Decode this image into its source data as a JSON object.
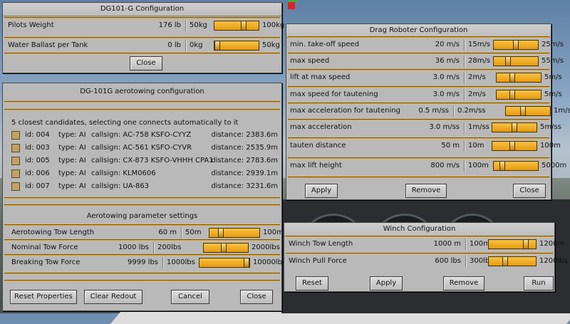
{
  "dg101": {
    "title": "DG101-G Configuration",
    "rows": [
      {
        "label": "Pilots Weight",
        "value": "176 lb",
        "min": "50kg",
        "max": "100kg",
        "pos": 0.68
      },
      {
        "label": "Water Ballast per Tank",
        "value": "0 lb",
        "min": "0kg",
        "max": "50kg",
        "pos": 0.0
      }
    ],
    "close": "Close"
  },
  "aerotow": {
    "title": "DG-101G aerotowing configuration",
    "intro": "5 closest candidates, selecting one connects automatically to it",
    "candidates": [
      {
        "id": "id: 004",
        "type": "type: AI",
        "callsign": "callsign: AC-758 KSFO-CYYZ",
        "distance": "distance: 2383.6m"
      },
      {
        "id": "id: 003",
        "type": "type: AI",
        "callsign": "callsign: AC-561 KSFO-CYVR",
        "distance": "distance: 2535.9m"
      },
      {
        "id": "id: 005",
        "type": "type: AI",
        "callsign": "callsign: CX-873 KSFO-VHHH CPA1",
        "distance": "distance: 2783.6m"
      },
      {
        "id": "id: 006",
        "type": "type: AI",
        "callsign": "callsign: KLM0606",
        "distance": "distance: 2939.1m"
      },
      {
        "id": "id: 007",
        "type": "type: AI",
        "callsign": "callsign: UA-863",
        "distance": "distance: 3231.6m"
      }
    ],
    "params_title": "Aerotowing parameter settings",
    "params": [
      {
        "label": "Aerotowing Tow Length",
        "value": "60 m",
        "min": "50m",
        "max": "100m",
        "pos": 0.2
      },
      {
        "label": "Nominal Tow Force",
        "value": "1000 lbs",
        "min": "200lbs",
        "max": "2000lbs",
        "pos": 0.45
      },
      {
        "label": "Breaking Tow Force",
        "value": "9999 lbs",
        "min": "1000lbs",
        "max": "10000lbs",
        "pos": 1.0
      }
    ],
    "buttons": {
      "reset": "Reset Properties",
      "clear": "Clear Redout",
      "cancel": "Cancel",
      "close": "Close"
    }
  },
  "drag": {
    "title": "Drag Roboter Configuration",
    "rows": [
      {
        "label": "min. take-off speed",
        "value": "20 m/s",
        "min": "15m/s",
        "max": "25m/s",
        "pos": 0.5
      },
      {
        "label": "max speed",
        "value": "36 m/s",
        "min": "28m/s",
        "max": "55m/s",
        "pos": 0.3
      },
      {
        "label": "lift at max speed",
        "value": "3.0 m/s",
        "min": "2m/s",
        "max": "5m/s",
        "pos": 0.33
      },
      {
        "label": "max speed for tautening",
        "value": "3.0 m/s",
        "min": "2m/s",
        "max": "5m/s",
        "pos": 0.33
      },
      {
        "label": "max acceleration for tautening",
        "value": "0.5 m/ss",
        "min": "0.2m/ss",
        "max": "1m/ss",
        "pos": 0.37
      },
      {
        "label": "max acceleration",
        "value": "3.0 m/ss",
        "min": "1m/ss",
        "max": "5m/ss",
        "pos": 0.5
      },
      {
        "label": "tauten distance",
        "value": "50 m",
        "min": "10m",
        "max": "100m",
        "pos": 0.44
      },
      {
        "label": "max lift height",
        "value": "800 m/s",
        "min": "100m",
        "max": "5000m",
        "pos": 0.14
      }
    ],
    "buttons": {
      "apply": "Apply",
      "remove": "Remove",
      "close": "Close"
    }
  },
  "winch": {
    "title": "Winch Configuration",
    "rows": [
      {
        "label": "Winch Tow Length",
        "value": "1000 m",
        "min": "100m",
        "max": "1200m",
        "pos": 0.82
      },
      {
        "label": "Winch Pull Force",
        "value": "600 lbs",
        "min": "300lbs",
        "max": "1200lbs",
        "pos": 0.33
      }
    ],
    "buttons": {
      "reset": "Reset",
      "apply": "Apply",
      "remove": "Remove",
      "run": "Run"
    }
  },
  "colors": {
    "slider": "#e9a31a",
    "dialog": "#b9b9b9",
    "separator": "#f0a818"
  }
}
